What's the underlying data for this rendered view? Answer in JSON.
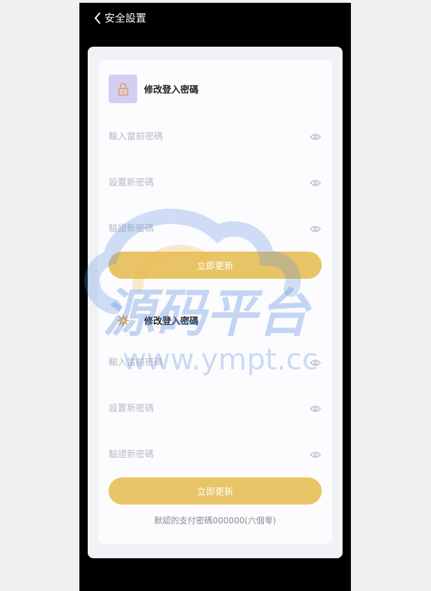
{
  "header": {
    "title": "安全設置"
  },
  "login_section": {
    "title": "修改登入密碼",
    "fields": [
      {
        "placeholder": "輸入當前密碼"
      },
      {
        "placeholder": "設置新密碼"
      },
      {
        "placeholder": "驗證新密碼"
      }
    ],
    "submit_label": "立即更新"
  },
  "pay_section": {
    "title": "修改登入密碼",
    "fields": [
      {
        "placeholder": "輸入當前密碼"
      },
      {
        "placeholder": "設置新密碼"
      },
      {
        "placeholder": "驗證新密碼"
      }
    ],
    "submit_label": "立即更新",
    "hint": "默認的支付密碼000000(六個零)"
  },
  "watermark": {
    "main": "源码平台",
    "url": "www.ympt.cc"
  },
  "colors": {
    "accent": "#e9c467",
    "lock_bg": "#d3cff2",
    "placeholder": "#b8bac2",
    "watermark_blue": "#5b8fe0",
    "watermark_orange": "#f2b74a"
  },
  "icons": {
    "back": "chevron-left-icon",
    "lock": "lock-icon",
    "gear": "gear-icon",
    "eye": "eye-icon"
  }
}
